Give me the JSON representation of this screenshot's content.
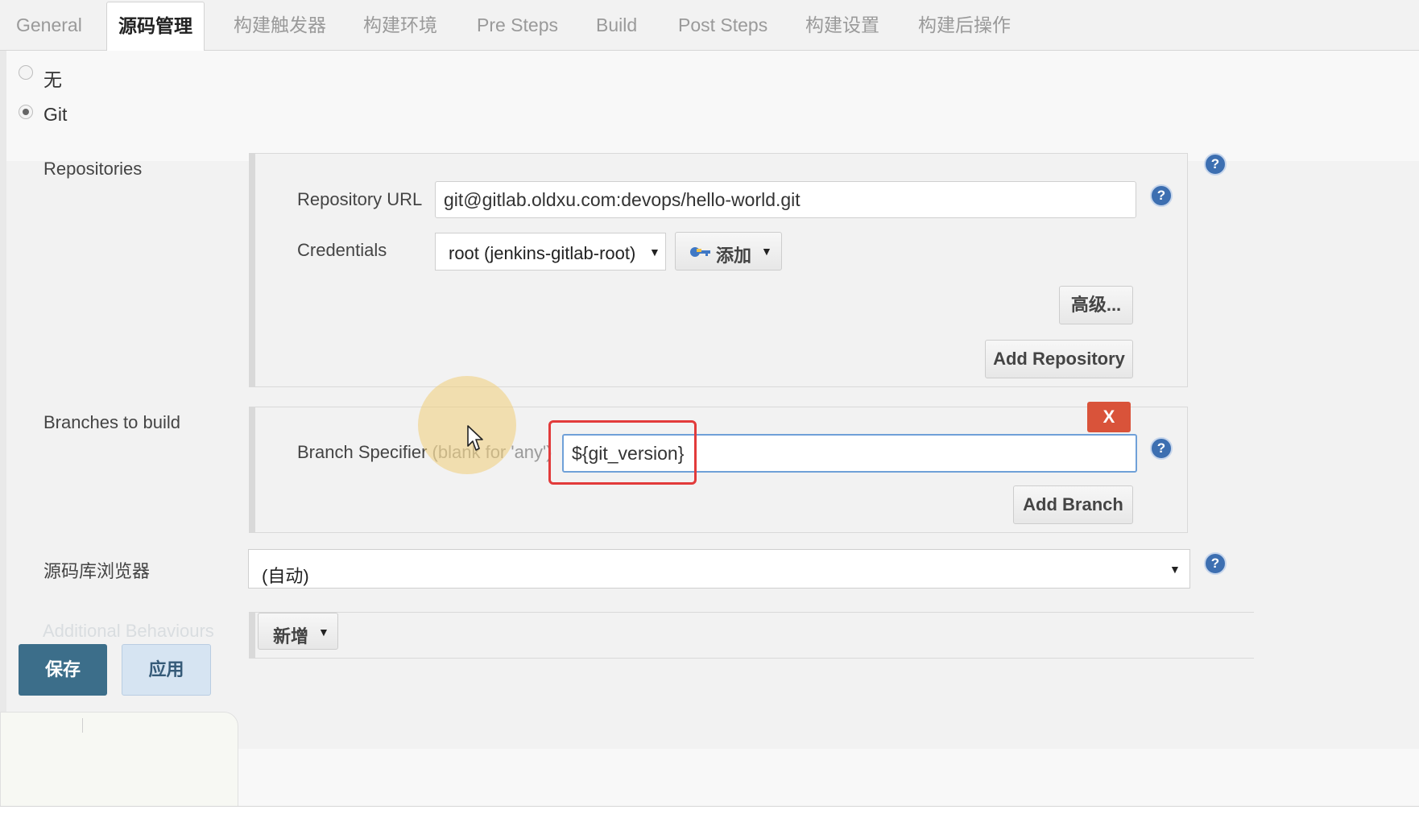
{
  "tabs": [
    {
      "label": "General"
    },
    {
      "label": "源码管理"
    },
    {
      "label": "构建触发器"
    },
    {
      "label": "构建环境"
    },
    {
      "label": "Pre Steps"
    },
    {
      "label": "Build"
    },
    {
      "label": "Post Steps"
    },
    {
      "label": "构建设置"
    },
    {
      "label": "构建后操作"
    }
  ],
  "scm": {
    "options": [
      {
        "label": "无",
        "selected": false
      },
      {
        "label": "Git",
        "selected": true
      }
    ]
  },
  "repositories": {
    "label": "Repositories",
    "url_label": "Repository URL",
    "url_value": "git@gitlab.oldxu.com:devops/hello-world.git",
    "credentials_label": "Credentials",
    "credentials_value": "root (jenkins-gitlab-root)",
    "add_credentials_label": "添加",
    "advanced_label": "高级...",
    "add_repository_label": "Add Repository"
  },
  "branches": {
    "label": "Branches to build",
    "specifier_label": "Branch Specifier",
    "specifier_hint": "(blank for 'any')",
    "specifier_value": "${git_version}",
    "delete_label": "X",
    "add_branch_label": "Add Branch"
  },
  "browser": {
    "label": "源码库浏览器",
    "value": "(自动)"
  },
  "additional": {
    "label": "Additional Behaviours",
    "add_label": "新增"
  },
  "footer_buttons": {
    "save": "保存",
    "apply": "应用"
  },
  "icons": {
    "help": "help-icon",
    "key": "key-icon",
    "caret": "caret-down-icon"
  },
  "colors": {
    "help_blue": "#3d6fb1",
    "delete_red": "#d9533a",
    "highlight_red": "#e23b3b",
    "save_blue": "#3c6e8a"
  }
}
